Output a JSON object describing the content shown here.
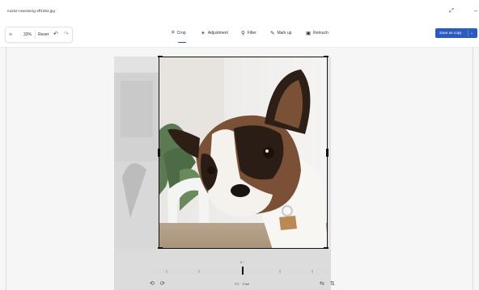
{
  "title_bar": {
    "file_name": "moritz-rosenberg-2ff1063.jpg",
    "minimize_glyph": "–",
    "expand_glyph": "⤢"
  },
  "toolbar": {
    "zoom_level": "33%",
    "reset_label": "Reset",
    "undo_glyph": "↶",
    "redo_glyph": "↷",
    "tools": [
      {
        "label": "Crop",
        "icon": "crop-icon",
        "glyph": "⌗"
      },
      {
        "label": "Adjustment",
        "icon": "adjustment-icon",
        "glyph": "☀"
      },
      {
        "label": "Filter",
        "icon": "filter-icon",
        "glyph": "⚲"
      },
      {
        "label": "Mark up",
        "icon": "markup-icon",
        "glyph": "✎"
      },
      {
        "label": "Retouch",
        "icon": "retouch-icon",
        "glyph": "▣"
      }
    ],
    "save_button": {
      "label": "Save as copy",
      "chevron": "⌄"
    }
  },
  "straighten_slider": {
    "value": "0 °"
  },
  "bottom_bar": {
    "rotate_left": "⟲",
    "rotate_right": "⟳",
    "aspect_ratio_label": "Free",
    "flip_horizontal": "⇆",
    "flip_vertical": "⇅"
  },
  "colors": {
    "accent": "#2a5bbf",
    "window_bg": "#f6f6f6",
    "toolbar_bg": "#ffffff"
  }
}
